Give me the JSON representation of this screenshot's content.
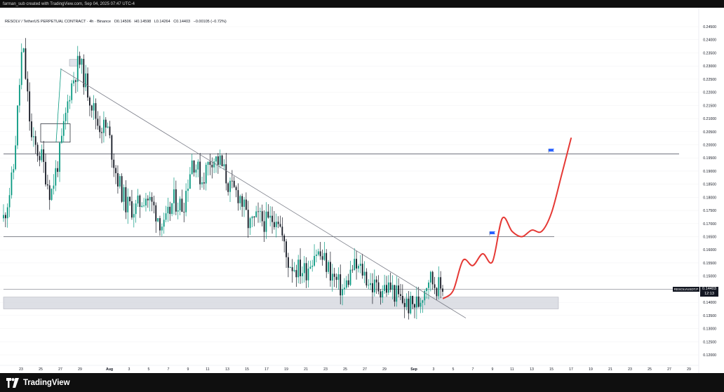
{
  "header": {
    "creator_line": "farman_sub created with TradingView.com, Sep 04, 2025 07:47 UTC-4"
  },
  "legend": {
    "symbol": "RESOLV / TetherUS PERPETUAL CONTRACT · 4h · Binance",
    "open": "O0.14506",
    "high": "H0.14598",
    "low": "L0.14264",
    "close": "C0.14403",
    "change": "−0.00105 (−0.72%)"
  },
  "price_badge": {
    "symbol_tag": "RESOLVUSDT.P",
    "price": "0.14403",
    "countdown": "12:13"
  },
  "footer": {
    "brand": "TradingView"
  },
  "colors": {
    "up": "#089981",
    "down": "#131722",
    "projection": "#e53935",
    "trendline": "#787b86",
    "level_line": "#5d606b",
    "support_zone": "#d1d4dc",
    "flag": "#2962ff"
  },
  "icons": {
    "logo": "tradingview-logo-icon",
    "flag": "flag-icon"
  },
  "chart_data": {
    "type": "candlestick",
    "title": "RESOLV / TetherUS PERPETUAL CONTRACT · 4h · Binance",
    "y_axis": {
      "ticks": [
        "0.24500",
        "0.24000",
        "0.23500",
        "0.23000",
        "0.22500",
        "0.22000",
        "0.21500",
        "0.21000",
        "0.20500",
        "0.20000",
        "0.19500",
        "0.19000",
        "0.18500",
        "0.18000",
        "0.17500",
        "0.17000",
        "0.16500",
        "0.16000",
        "0.15500",
        "0.15000",
        "0.14500",
        "0.14000",
        "0.13500",
        "0.13000",
        "0.12500",
        "0.12000"
      ],
      "ylim": [
        0.1195,
        0.2475
      ]
    },
    "x_axis": {
      "ticks": [
        "23",
        "25",
        "27",
        "29",
        "Aug",
        "3",
        "5",
        "7",
        "9",
        "11",
        "13",
        "15",
        "17",
        "19",
        "21",
        "23",
        "25",
        "27",
        "29",
        "Sep",
        "3",
        "5",
        "7",
        "9",
        "11",
        "13",
        "15",
        "17",
        "19",
        "21",
        "23",
        "25",
        "27",
        "29"
      ]
    },
    "horizontal_levels": [
      0.1965,
      0.165,
      0.145
    ],
    "support_zone": [
      0.1375,
      0.142
    ],
    "trendline": {
      "from": [
        "Jul 27",
        0.229
      ],
      "to": [
        "Sep 5",
        0.134
      ]
    },
    "consolidation_box": {
      "from": [
        "Jul 25",
        0.201
      ],
      "to": [
        "Jul 28",
        0.208
      ]
    },
    "last_price": 0.14403,
    "projection_path": [
      [
        "Sep 4",
        0.1415
      ],
      [
        "Sep 5",
        0.1445
      ],
      [
        "Sep 6",
        0.156
      ],
      [
        "Sep 7",
        0.154
      ],
      [
        "Sep 8",
        0.1585
      ],
      [
        "Sep 9",
        0.1555
      ],
      [
        "Sep 10",
        0.172
      ],
      [
        "Sep 11",
        0.167
      ],
      [
        "Sep 12",
        0.165
      ],
      [
        "Sep 13",
        0.1675
      ],
      [
        "Sep 14",
        0.167
      ],
      [
        "Sep 15",
        0.174
      ],
      [
        "Sep 16",
        0.188
      ],
      [
        "Sep 17",
        0.2025
      ]
    ],
    "flags": [
      [
        "Sep 9",
        0.167
      ],
      [
        "Sep 15",
        0.1985
      ]
    ],
    "candle_anchors": [
      [
        0,
        0.172
      ],
      [
        2,
        0.188
      ],
      [
        4,
        0.2385
      ],
      [
        6,
        0.201
      ],
      [
        8,
        0.1955
      ],
      [
        10,
        0.181
      ],
      [
        12,
        0.1975
      ],
      [
        14,
        0.2205
      ],
      [
        16,
        0.232
      ],
      [
        18,
        0.22
      ],
      [
        20,
        0.208
      ],
      [
        22,
        0.206
      ],
      [
        24,
        0.188
      ],
      [
        26,
        0.177
      ],
      [
        28,
        0.1755
      ],
      [
        30,
        0.181
      ],
      [
        32,
        0.1755
      ],
      [
        34,
        0.168
      ],
      [
        36,
        0.179
      ],
      [
        38,
        0.1765
      ],
      [
        40,
        0.195
      ],
      [
        42,
        0.1865
      ],
      [
        44,
        0.1955
      ],
      [
        46,
        0.193
      ],
      [
        48,
        0.183
      ],
      [
        50,
        0.181
      ],
      [
        52,
        0.169
      ],
      [
        54,
        0.172
      ],
      [
        56,
        0.17
      ],
      [
        58,
        0.174
      ],
      [
        60,
        0.156
      ],
      [
        62,
        0.153
      ],
      [
        64,
        0.152
      ],
      [
        66,
        0.16
      ],
      [
        68,
        0.1555
      ],
      [
        70,
        0.149
      ],
      [
        72,
        0.144
      ],
      [
        74,
        0.1535
      ],
      [
        76,
        0.152
      ],
      [
        78,
        0.146
      ],
      [
        80,
        0.1455
      ],
      [
        82,
        0.1455
      ],
      [
        84,
        0.141
      ],
      [
        86,
        0.1385
      ],
      [
        88,
        0.14
      ],
      [
        90,
        0.15
      ],
      [
        92,
        0.146
      ],
      [
        93,
        0.144
      ]
    ],
    "candle_count": 220
  }
}
